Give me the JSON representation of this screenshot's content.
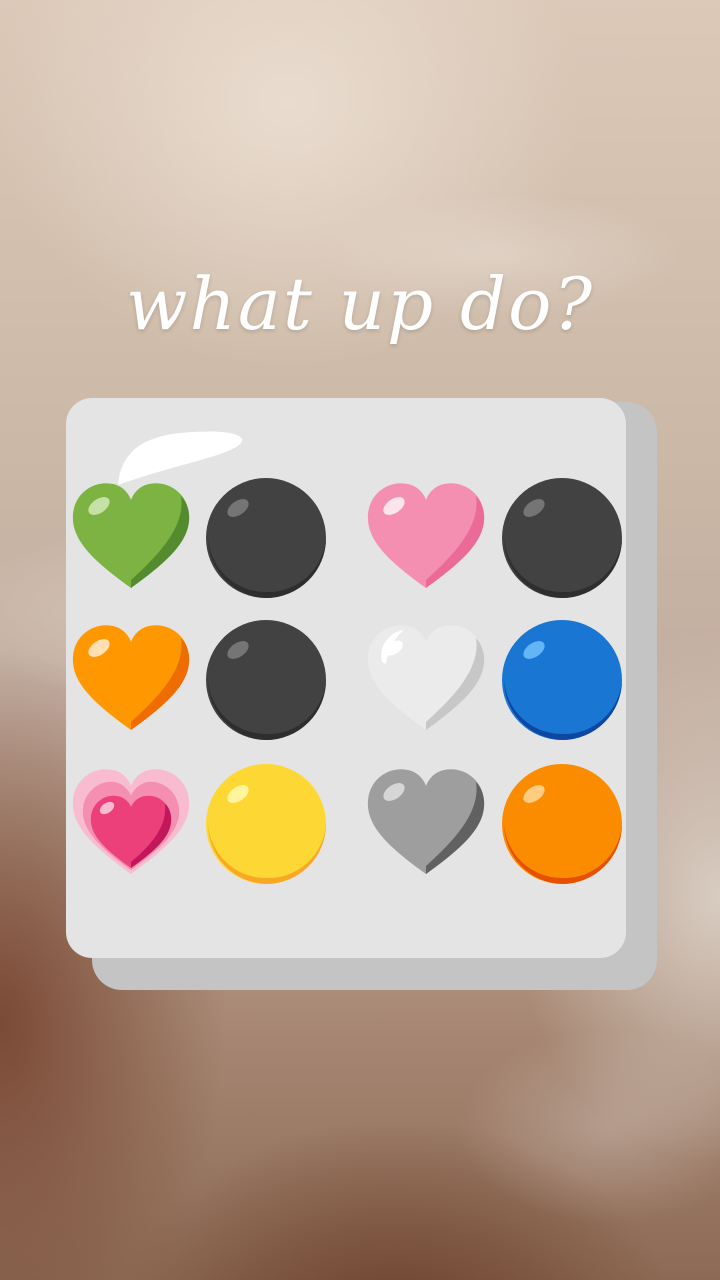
{
  "title": "what up do?",
  "board": {
    "colors": {
      "board": "#e4e4e4",
      "board_shadow": "#c4c4c4"
    },
    "rows": [
      [
        {
          "icon": "green-heart-icon",
          "color": "#7cb342"
        },
        {
          "icon": "black-circle-icon",
          "color": "#424242"
        },
        {
          "icon": "pink-heart-icon",
          "color": "#f48fb1"
        },
        {
          "icon": "black-circle-icon",
          "color": "#424242"
        }
      ],
      [
        {
          "icon": "orange-heart-icon",
          "color": "#ff9800"
        },
        {
          "icon": "black-circle-icon",
          "color": "#424242"
        },
        {
          "icon": "white-heart-icon",
          "color": "#f5f5f5"
        },
        {
          "icon": "blue-circle-icon",
          "color": "#1976d2"
        }
      ],
      [
        {
          "icon": "growing-heart-icon",
          "color": "#ec407a"
        },
        {
          "icon": "yellow-circle-icon",
          "color": "#fdd835"
        },
        {
          "icon": "grey-heart-icon",
          "color": "#9e9e9e"
        },
        {
          "icon": "orange-circle-icon",
          "color": "#fb8c00"
        }
      ]
    ]
  }
}
